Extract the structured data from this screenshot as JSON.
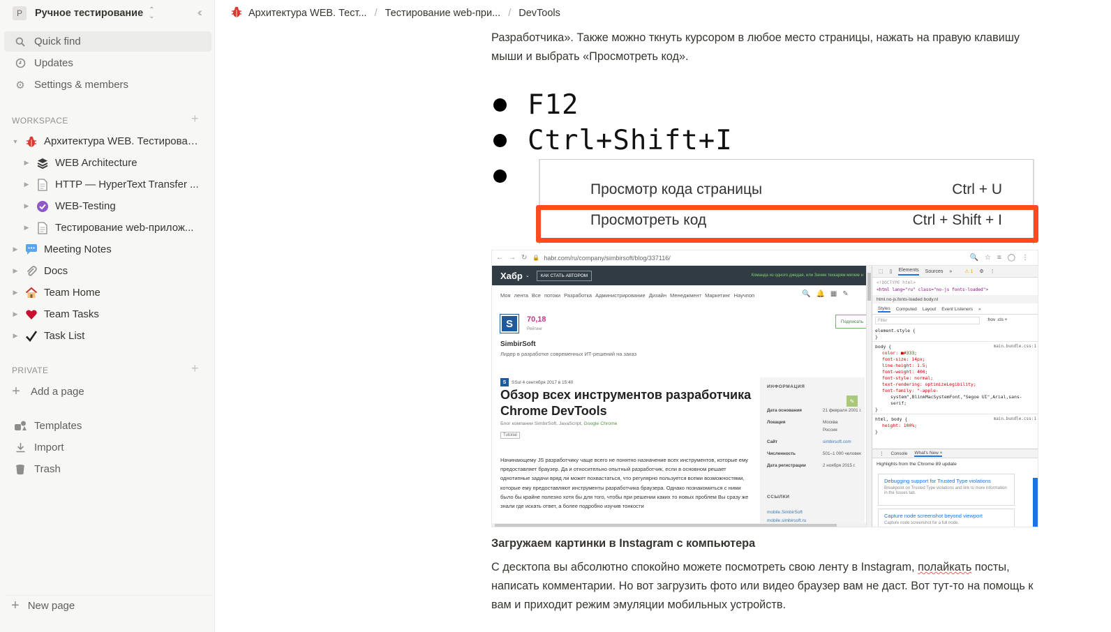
{
  "sidebar": {
    "workspace": {
      "initial": "P",
      "name": "Ручное тестирование"
    },
    "quick_find": "Quick find",
    "updates": "Updates",
    "settings": "Settings & members",
    "workspace_label": "WORKSPACE",
    "pages": [
      {
        "label": "Архитектура WEB. Тестирован...",
        "icon": "bug-icon"
      },
      {
        "label": "WEB Architecture",
        "icon": "layers-icon"
      },
      {
        "label": "HTTP — HyperText Transfer ...",
        "icon": "page-icon"
      },
      {
        "label": "WEB-Testing",
        "icon": "check-circle-icon"
      },
      {
        "label": "Тестирование web-прилож...",
        "icon": "page-icon"
      },
      {
        "label": "Meeting Notes",
        "icon": "speech-bubble-icon"
      },
      {
        "label": "Docs",
        "icon": "paperclip-icon"
      },
      {
        "label": "Team Home",
        "icon": "house-icon"
      },
      {
        "label": "Team Tasks",
        "icon": "heart-icon"
      },
      {
        "label": "Task List",
        "icon": "checkmark-icon"
      }
    ],
    "private_label": "PRIVATE",
    "add_page": "Add a page",
    "templates": "Templates",
    "import": "Import",
    "trash": "Trash",
    "new_page": "New page"
  },
  "breadcrumb": {
    "items": [
      "Архитектура WEB. Тест...",
      "Тестирование web-при...",
      "DevTools"
    ],
    "separator": "/"
  },
  "content": {
    "intro": "Разработчика». Также можно ткнуть курсором в любое место страницы, нажать на правую клавишу мыши и выбрать «Просмотреть код».",
    "shortcut1": "F12",
    "shortcut2": "Ctrl+Shift+I",
    "menu": [
      {
        "label": "Просмотр кода страницы",
        "shortcut": "Ctrl + U"
      },
      {
        "label": "Просмотреть код",
        "shortcut": "Ctrl + Shift + I"
      }
    ],
    "heading": "Загружаем картинки в Instagram с компьютера",
    "para_before": "С десктопа вы абсолютно спокойно можете посмотреть свою ленту в Instagram, ",
    "para_wavy": "полайкать",
    "para_after": " посты, написать комментарии. Но вот загрузить фото или видео браузер вам не даст. Вот тут-то на помощь к вам и приходит режим эмуляции мобильных устройств."
  },
  "screenshot": {
    "url": "habr.com/ru/company/simbirsoft/blog/337116/",
    "habr_logo": "Хабр",
    "habr_button": "КАК СТАТЬ АВТОРОМ",
    "habr_promo": "Команда из одного джедая, или Зачем техкарям мягкие н",
    "nav": "Моя лента   Все потоки   Разработка   Администрирование   Дизайн   Менеджмент   Маркетинг   Научпоп",
    "logo_letter": "S",
    "rating": "70,18",
    "rating_label": "Рейтинг",
    "company": "SimbirSoft",
    "company_desc": "Лидер в разработке современных ИТ-решений на заказ",
    "subscribe": "Подписать",
    "post_meta": "SSul   4 сентября 2017 в 15:40",
    "post_title": "Обзор всех инструментов разработчика Chrome DevTools",
    "post_hubs_prefix": "Блог компании SimbirSoft,  JavaScript,  ",
    "post_hubs_green": "Google Chrome",
    "post_tag": "Tutorial",
    "post_body": "Начинающему JS разработчику чаще всего не понятно назначение всех инструментов, которые ему предоставляет браузер. Да и относительно опытный разработчик, если в основном решает однотипные задачи вряд ли может похвастаться, что регулярно пользуется всеми возможностями, которые ему предоставляют инструменты разработчика браузера. Однако познакомиться с ними было бы крайне полезно хотя бы для того, чтобы при решении каких то новых проблем Вы сразу же знали где искать ответ, а более подробно изучив тонкости",
    "info_title": "ИНФОРМАЦИЯ",
    "info": [
      {
        "k": "Дата основания",
        "v": "21 февраля 2001 г."
      },
      {
        "k": "Локация",
        "v": "Москва"
      },
      {
        "k": "",
        "v": "Россия"
      },
      {
        "k": "Сайт",
        "v": "simbirsoft.com"
      },
      {
        "k": "Численность",
        "v": "501–1 000 человек"
      },
      {
        "k": "Дата регистрации",
        "v": "2 ноября 2015 г."
      }
    ],
    "links_title": "ССЫЛКИ",
    "links": [
      "mobile.SimbirSoft",
      "mobile.simbirsoft.ru"
    ],
    "devtools": {
      "tabs": [
        "Elements",
        "Sources",
        "»"
      ],
      "warn": "⚠ 1",
      "doctype": "<!DOCTYPE html>",
      "html_tag": "<html lang=\"ru\" class=\"no-js fonts-loaded\">",
      "crumbs": "html.no-js.fonts-loaded   body.nl",
      "subtabs": [
        "Styles",
        "Computed",
        "Layout",
        "Event Listeners",
        "»"
      ],
      "filter": "Filter",
      "filter_tools": ":hov  .cls  +",
      "rules": [
        "element.style {",
        "}",
        "body {",
        "color: ■#333;",
        "font-size: 14px;",
        "line-height: 1.5;",
        "font-weight: 400;",
        "font-style: normal;",
        "text-rendering: optimizeLegibility;",
        "font-family: \"-apple-",
        "system\",BlinkMacSystemFont,\"Segoe UI\",Arial,sans-",
        "serif;",
        "}",
        "html, body {",
        "height: 100%;",
        "}"
      ],
      "src": "main.bundle.css:1",
      "console_tabs": [
        "Console",
        "What's New ×"
      ],
      "highlights": "Highlights from the Chrome 89 update",
      "card1_title": "Debugging support for Trusted Type violations",
      "card1_desc": "Breakpoint on Trusted Type violations and link to more information in the Issues tab.",
      "card2_title": "Capture node screenshot beyond viewport",
      "card2_desc": "Capture node screenshot for a full node."
    }
  }
}
